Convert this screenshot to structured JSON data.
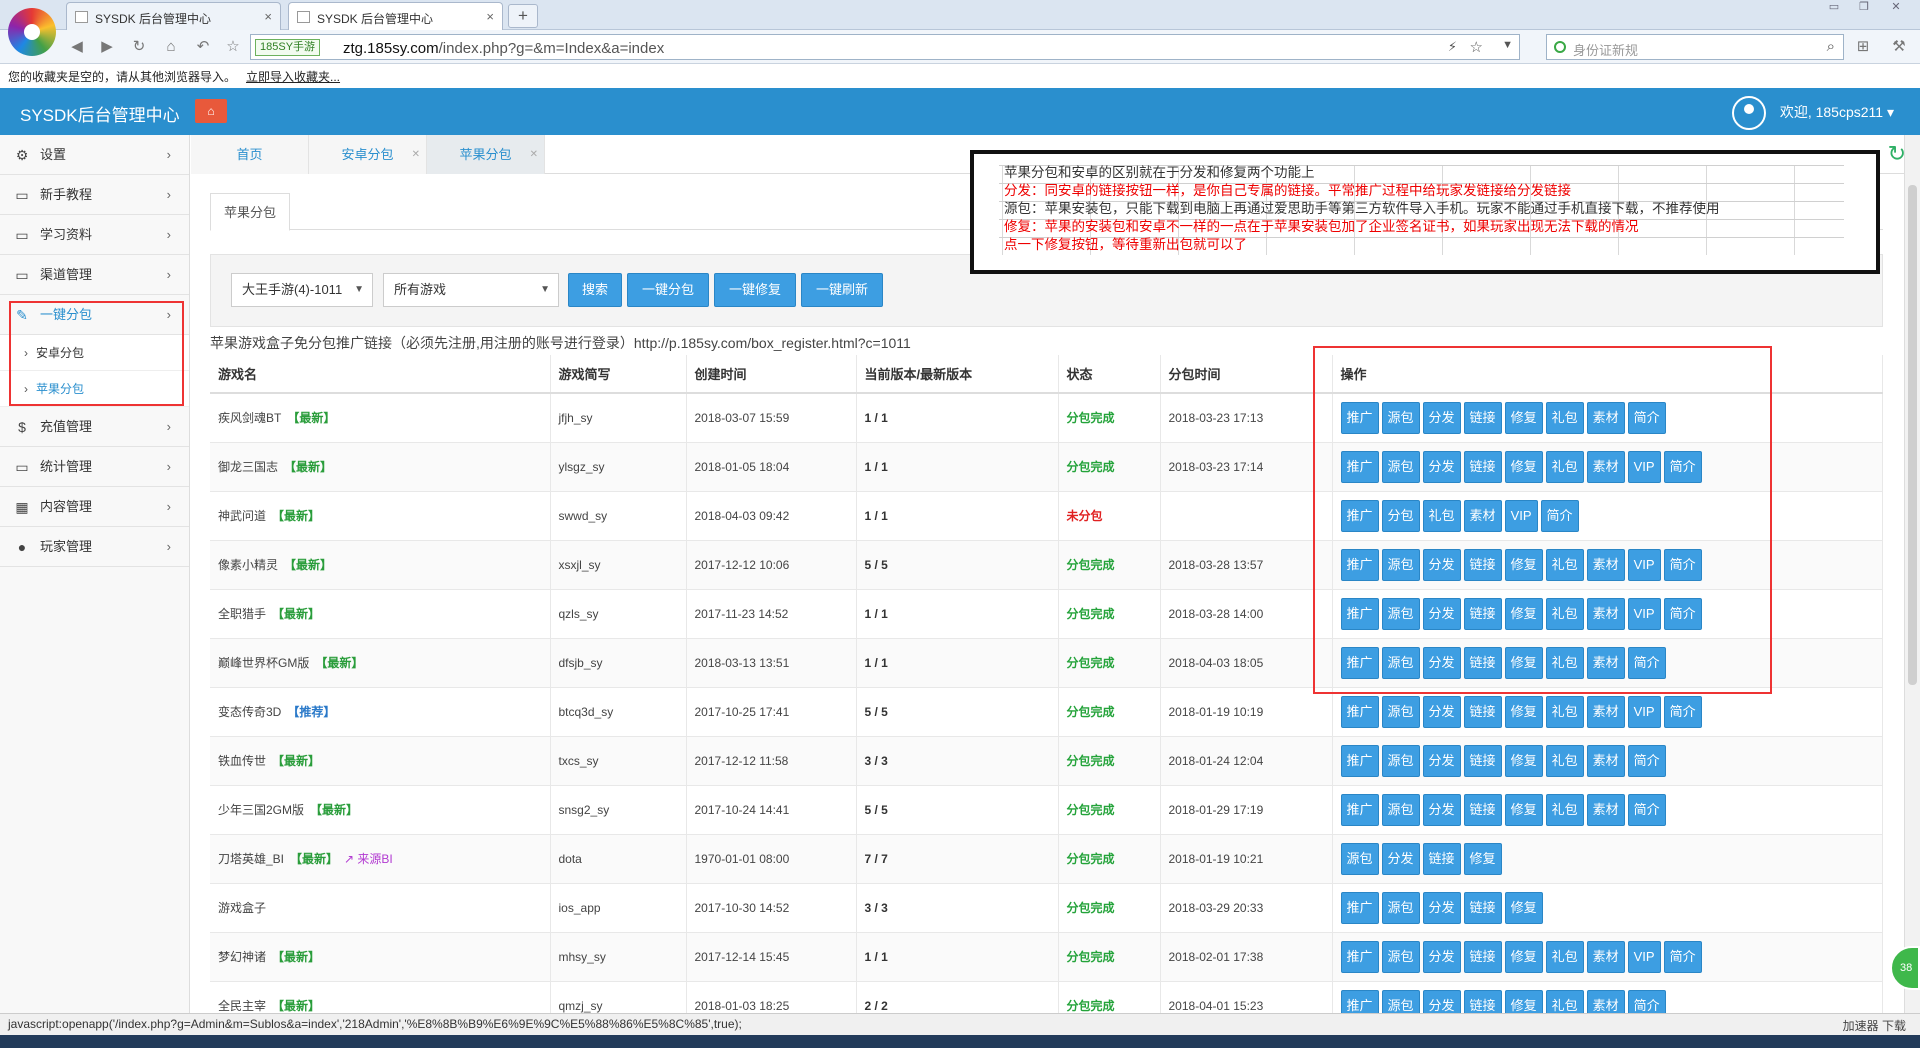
{
  "browser": {
    "tabs": [
      {
        "title": "SYSDK 后台管理中心"
      },
      {
        "title": "SYSDK 后台管理中心"
      }
    ],
    "site_badge": "185SY手游",
    "url_host": "ztg.185sy.com",
    "url_path": "/index.php?g=&m=Index&a=index",
    "search_placeholder": "身份证新规",
    "bookmark_msg": "您的收藏夹是空的，请从其他浏览器导入。",
    "bookmark_link": "立即导入收藏夹..."
  },
  "header": {
    "brand": "SYSDK后台管理中心",
    "home_label": "⌂",
    "welcome": "欢迎, 185cps211 ▾"
  },
  "sidebar": {
    "items": [
      {
        "label": "设置",
        "icon": "⚙"
      },
      {
        "label": "新手教程",
        "icon": "▭"
      },
      {
        "label": "学习资料",
        "icon": "▭"
      },
      {
        "label": "渠道管理",
        "icon": "▭"
      },
      {
        "label": "一键分包",
        "icon": "✎"
      },
      {
        "label": "充值管理",
        "icon": "$"
      },
      {
        "label": "统计管理",
        "icon": "▭"
      },
      {
        "label": "内容管理",
        "icon": "▦"
      },
      {
        "label": "玩家管理",
        "icon": "●"
      }
    ],
    "sub_items": [
      {
        "label": "安卓分包"
      },
      {
        "label": "苹果分包"
      }
    ]
  },
  "page_tabs": [
    {
      "label": "首页"
    },
    {
      "label": "安卓分包"
    },
    {
      "label": "苹果分包"
    }
  ],
  "subtab": "苹果分包",
  "filter": {
    "channel": "大王手游(4)-1011",
    "game": "所有游戏",
    "buttons": [
      "搜索",
      "一键分包",
      "一键修复",
      "一键刷新"
    ]
  },
  "promo_text": "苹果游戏盒子免分包推广链接（必须先注册,用注册的账号进行登录）http://p.185sy.com/box_register.html?c=1011",
  "note": {
    "line1": "苹果分包和安卓的区别就在于分发和修复两个功能上",
    "line2": "分发：同安卓的链接按钮一样，是你自己专属的链接。平常推广过程中给玩家发链接给分发链接",
    "line3": "源包：苹果安装包，只能下载到电脑上再通过爱思助手等第三方软件导入手机。玩家不能通过手机直接下载，不推荐使用",
    "line4": "修复：苹果的安装包和安卓不一样的一点在于苹果安装包加了企业签名证书，如果玩家出现无法下载的情况",
    "line5": "点一下修复按钮，等待重新出包就可以了"
  },
  "table": {
    "headers": [
      "游戏名",
      "游戏简写",
      "创建时间",
      "当前版本/最新版本",
      "状态",
      "分包时间",
      "操作"
    ],
    "rows": [
      {
        "name": "疾风剑魂BT",
        "tag": "【最新】",
        "tag_color": "green",
        "abbr": "jfjh_sy",
        "created": "2018-03-07 15:59",
        "version": "1 / 1",
        "status": "分包完成",
        "status_ok": true,
        "pack_time": "2018-03-23 17:13",
        "ops": [
          "推广",
          "源包",
          "分发",
          "链接",
          "修复",
          "礼包",
          "素材",
          "简介"
        ]
      },
      {
        "name": "御龙三国志",
        "tag": "【最新】",
        "tag_color": "green",
        "abbr": "ylsgz_sy",
        "created": "2018-01-05 18:04",
        "version": "1 / 1",
        "status": "分包完成",
        "status_ok": true,
        "pack_time": "2018-03-23 17:14",
        "ops": [
          "推广",
          "源包",
          "分发",
          "链接",
          "修复",
          "礼包",
          "素材",
          "VIP",
          "简介"
        ]
      },
      {
        "name": "神武问道",
        "tag": "【最新】",
        "tag_color": "green",
        "abbr": "swwd_sy",
        "created": "2018-04-03 09:42",
        "version": "1 / 1",
        "status": "未分包",
        "status_ok": false,
        "pack_time": "",
        "ops": [
          "推广",
          "分包",
          "礼包",
          "素材",
          "VIP",
          "简介"
        ]
      },
      {
        "name": "像素小精灵",
        "tag": "【最新】",
        "tag_color": "green",
        "abbr": "xsxjl_sy",
        "created": "2017-12-12 10:06",
        "version": "5 / 5",
        "status": "分包完成",
        "status_ok": true,
        "pack_time": "2018-03-28 13:57",
        "ops": [
          "推广",
          "源包",
          "分发",
          "链接",
          "修复",
          "礼包",
          "素材",
          "VIP",
          "简介"
        ]
      },
      {
        "name": "全职猎手",
        "tag": "【最新】",
        "tag_color": "green",
        "abbr": "qzls_sy",
        "created": "2017-11-23 14:52",
        "version": "1 / 1",
        "status": "分包完成",
        "status_ok": true,
        "pack_time": "2018-03-28 14:00",
        "ops": [
          "推广",
          "源包",
          "分发",
          "链接",
          "修复",
          "礼包",
          "素材",
          "VIP",
          "简介"
        ]
      },
      {
        "name": "巅峰世界杯GM版",
        "tag": "【最新】",
        "tag_color": "green",
        "abbr": "dfsjb_sy",
        "created": "2018-03-13 13:51",
        "version": "1 / 1",
        "status": "分包完成",
        "status_ok": true,
        "pack_time": "2018-04-03 18:05",
        "ops": [
          "推广",
          "源包",
          "分发",
          "链接",
          "修复",
          "礼包",
          "素材",
          "简介"
        ]
      },
      {
        "name": "变态传奇3D",
        "tag": "【推荐】",
        "tag_color": "blue",
        "abbr": "btcq3d_sy",
        "created": "2017-10-25 17:41",
        "version": "5 / 5",
        "status": "分包完成",
        "status_ok": true,
        "pack_time": "2018-01-19 10:19",
        "ops": [
          "推广",
          "源包",
          "分发",
          "链接",
          "修复",
          "礼包",
          "素材",
          "VIP",
          "简介"
        ]
      },
      {
        "name": "铁血传世",
        "tag": "【最新】",
        "tag_color": "green",
        "abbr": "txcs_sy",
        "created": "2017-12-12 11:58",
        "version": "3 / 3",
        "status": "分包完成",
        "status_ok": true,
        "pack_time": "2018-01-24 12:04",
        "ops": [
          "推广",
          "源包",
          "分发",
          "链接",
          "修复",
          "礼包",
          "素材",
          "简介"
        ]
      },
      {
        "name": "少年三国2GM版",
        "tag": "【最新】",
        "tag_color": "green",
        "abbr": "snsg2_sy",
        "created": "2017-10-24 14:41",
        "version": "5 / 5",
        "status": "分包完成",
        "status_ok": true,
        "pack_time": "2018-01-29 17:19",
        "ops": [
          "推广",
          "源包",
          "分发",
          "链接",
          "修复",
          "礼包",
          "素材",
          "简介"
        ]
      },
      {
        "name": "刀塔英雄_BI",
        "tag": "【最新】",
        "tag_color": "green",
        "extra": "↗ 来源BI",
        "abbr": "dota",
        "created": "1970-01-01 08:00",
        "version": "7 / 7",
        "status": "分包完成",
        "status_ok": true,
        "pack_time": "2018-01-19 10:21",
        "ops": [
          "源包",
          "分发",
          "链接",
          "修复"
        ]
      },
      {
        "name": "游戏盒子",
        "tag": "",
        "tag_color": "green",
        "abbr": "ios_app",
        "created": "2017-10-30 14:52",
        "version": "3 / 3",
        "status": "分包完成",
        "status_ok": true,
        "pack_time": "2018-03-29 20:33",
        "ops": [
          "推广",
          "源包",
          "分发",
          "链接",
          "修复"
        ]
      },
      {
        "name": "梦幻神诸",
        "tag": "【最新】",
        "tag_color": "green",
        "abbr": "mhsy_sy",
        "created": "2017-12-14 15:45",
        "version": "1 / 1",
        "status": "分包完成",
        "status_ok": true,
        "pack_time": "2018-02-01 17:38",
        "ops": [
          "推广",
          "源包",
          "分发",
          "链接",
          "修复",
          "礼包",
          "素材",
          "VIP",
          "简介"
        ]
      },
      {
        "name": "全民主宰",
        "tag": "【最新】",
        "tag_color": "green",
        "abbr": "qmzj_sy",
        "created": "2018-01-03 18:25",
        "version": "2 / 2",
        "status": "分包完成",
        "status_ok": true,
        "pack_time": "2018-04-01 15:23",
        "ops": [
          "推广",
          "源包",
          "分发",
          "链接",
          "修复",
          "礼包",
          "素材",
          "简介"
        ]
      }
    ]
  },
  "status_bar": {
    "url": "javascript:openapp('/index.php?g=Admin&m=Sublos&a=index','218Admin','%E8%8B%B9%E6%9E%9C%E5%88%86%E5%8C%85',true);",
    "right": "加速器   下载"
  },
  "side_badge": "38"
}
